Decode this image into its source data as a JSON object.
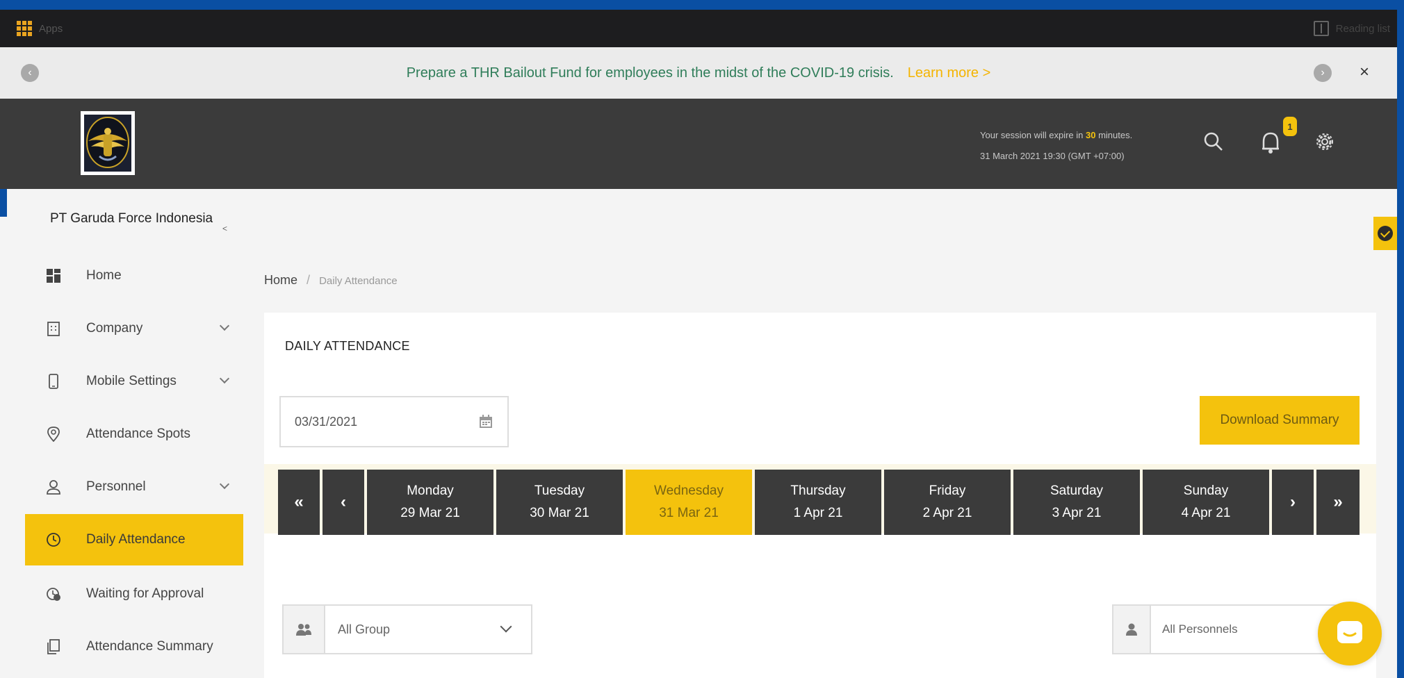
{
  "browser": {
    "apps_label": "Apps",
    "reading_list_label": "Reading list"
  },
  "announcement": {
    "text": "Prepare a THR Bailout Fund for employees in the midst of the COVID-19 crisis.",
    "link": "Learn more >",
    "close": "×"
  },
  "header": {
    "session_prefix": "Your session will expire in ",
    "session_minutes": "30",
    "session_suffix": " minutes.",
    "datetime": "31 March 2021 19:30 (GMT +07:00)",
    "notification_count": "1"
  },
  "sidebar": {
    "company": "PT Garuda Force Indonesia",
    "collapse": "<",
    "items": [
      {
        "label": "Home",
        "icon": "dashboard-icon"
      },
      {
        "label": "Company",
        "icon": "building-icon",
        "has_chevron": true
      },
      {
        "label": "Mobile Settings",
        "icon": "mobile-icon",
        "has_chevron": true
      },
      {
        "label": "Attendance Spots",
        "icon": "location-pin-icon"
      },
      {
        "label": "Personnel",
        "icon": "user-icon",
        "has_chevron": true
      },
      {
        "label": "Daily Attendance",
        "icon": "clock-icon",
        "active": true
      },
      {
        "label": "Waiting for Approval",
        "icon": "clock-pending-icon"
      },
      {
        "label": "Attendance Summary",
        "icon": "copy-icon"
      }
    ]
  },
  "breadcrumb": {
    "home": "Home",
    "separator": "/",
    "current": "Daily Attendance"
  },
  "card": {
    "title": "DAILY ATTENDANCE",
    "date_value": "03/31/2021",
    "download_label": "Download Summary",
    "week": {
      "first_label": "«",
      "prev_label": "‹",
      "next_label": "›",
      "last_label": "»",
      "days": [
        {
          "day": "Monday",
          "date": "29 Mar 21"
        },
        {
          "day": "Tuesday",
          "date": "30 Mar 21"
        },
        {
          "day": "Wednesday",
          "date": "31 Mar 21",
          "active": true
        },
        {
          "day": "Thursday",
          "date": "1 Apr 21"
        },
        {
          "day": "Friday",
          "date": "2 Apr 21"
        },
        {
          "day": "Saturday",
          "date": "3 Apr 21"
        },
        {
          "day": "Sunday",
          "date": "4 Apr 21"
        }
      ]
    },
    "group_filter": "All Group",
    "personnel_filter": "All Personnels"
  },
  "colors": {
    "accent": "#f4c20d",
    "header_bg": "#3b3b3b",
    "frame": "#0a4fa3",
    "announce_text": "#2f7d59"
  }
}
